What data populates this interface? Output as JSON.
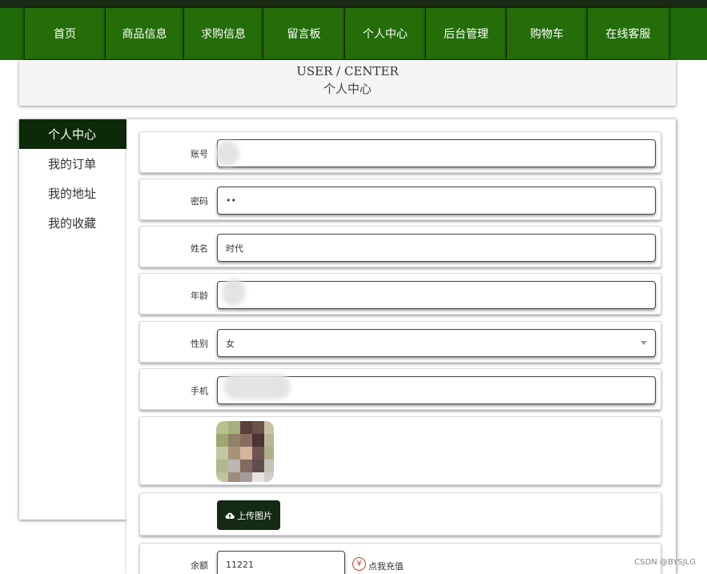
{
  "nav": {
    "items": [
      {
        "label": "首页"
      },
      {
        "label": "商品信息"
      },
      {
        "label": "求购信息"
      },
      {
        "label": "留言板"
      },
      {
        "label": "个人中心"
      },
      {
        "label": "后台管理"
      },
      {
        "label": "购物车"
      },
      {
        "label": "在线客服"
      }
    ]
  },
  "banner": {
    "title_en": "USER / CENTER",
    "title_zh": "个人中心"
  },
  "sidebar": {
    "items": [
      {
        "label": "个人中心",
        "active": true
      },
      {
        "label": "我的订单",
        "active": false
      },
      {
        "label": "我的地址",
        "active": false
      },
      {
        "label": "我的收藏",
        "active": false
      }
    ]
  },
  "form": {
    "account": {
      "label": "账号",
      "value": ""
    },
    "password": {
      "label": "密码",
      "value": "••"
    },
    "name": {
      "label": "姓名",
      "value": "时代"
    },
    "age": {
      "label": "年龄",
      "value": ""
    },
    "gender": {
      "label": "性别",
      "value": "女"
    },
    "phone": {
      "label": "手机",
      "value": ""
    },
    "upload_label": "上传图片",
    "balance": {
      "label": "余额",
      "value": "11221"
    },
    "recharge_label": "点我充值",
    "recharge_icon": "¥"
  },
  "watermark": "CSDN @BYSJLG",
  "colors": {
    "nav_bg": "#246d09",
    "active_side": "#0d2a08",
    "upload_btn": "#142a12",
    "recharge_icon": "#d03a2c"
  }
}
